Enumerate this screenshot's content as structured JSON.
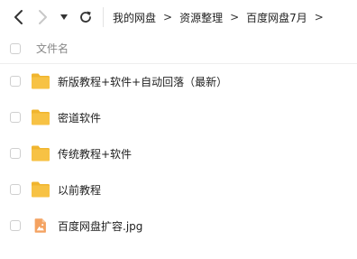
{
  "toolbar": {
    "back_icon": "chevron-left-icon",
    "forward_icon": "chevron-right-icon",
    "history_dropdown_icon": "caret-down-icon",
    "refresh_icon": "refresh-icon"
  },
  "breadcrumb": {
    "items": [
      "我的网盘",
      "资源整理",
      "百度网盘7月"
    ],
    "separator": ">"
  },
  "list_header": {
    "name_label": "文件名"
  },
  "files": [
    {
      "name": "新版教程+软件+自动回落（最新）",
      "icon": "folder-icon",
      "type": "folder"
    },
    {
      "name": "密道软件",
      "icon": "folder-icon",
      "type": "folder"
    },
    {
      "name": "传统教程+软件",
      "icon": "folder-icon",
      "type": "folder"
    },
    {
      "name": "以前教程",
      "icon": "folder-icon",
      "type": "folder"
    },
    {
      "name": "百度网盘扩容.jpg",
      "icon": "image-file-icon",
      "type": "image"
    }
  ],
  "colors": {
    "folder": "#f7c244",
    "folder_dark": "#f0b52f",
    "image_file": "#f4a261",
    "text": "#222222",
    "muted": "#888888",
    "nav_active": "#333333",
    "nav_disabled": "#c8c8c8"
  }
}
